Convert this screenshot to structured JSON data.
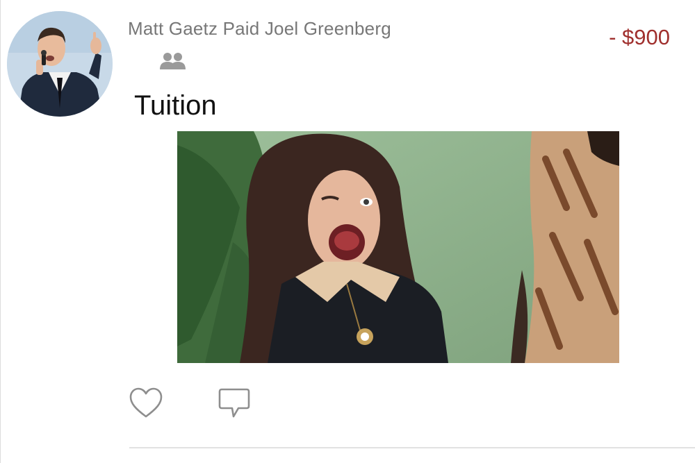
{
  "post": {
    "avatar_icon": "profile-photo",
    "headline": "Matt Gaetz Paid Joel Greenberg",
    "amount": "- $900",
    "amount_color": "#a0302e",
    "audience_icon": "friends-icon",
    "note": "Tuition",
    "media_icon": "attached-gif-image"
  },
  "actions": {
    "like_icon": "heart-outline-icon",
    "comment_icon": "speech-bubble-icon"
  }
}
